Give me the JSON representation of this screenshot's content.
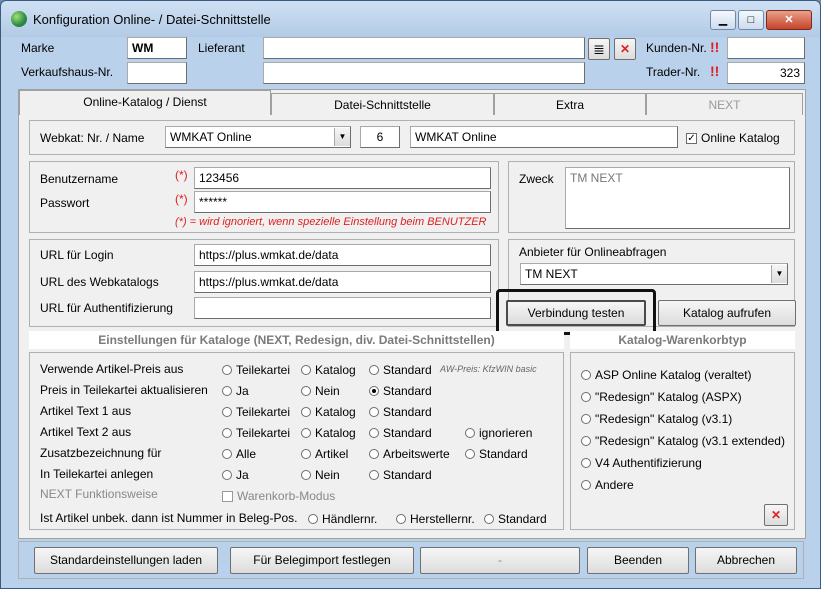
{
  "window": {
    "title": "Konfiguration Online- / Datei-Schnittstelle",
    "btn_min": "▁",
    "btn_max": "□",
    "btn_close": "✕"
  },
  "header": {
    "marke_label": "Marke",
    "marke_value": "WM",
    "lieferant_label": "Lieferant",
    "lieferant_value": "",
    "kunden_label": "Kunden-Nr.",
    "kunden_value": "",
    "verkaufshaus_label": "Verkaufshaus-Nr.",
    "verkaufshaus_value": "",
    "trader_label": "Trader-Nr.",
    "trader_value": "323",
    "warning_mark": "!!"
  },
  "tabs": [
    {
      "label": "Online-Katalog / Dienst",
      "active": true
    },
    {
      "label": "Datei-Schnittstelle",
      "active": false
    },
    {
      "label": "Extra",
      "active": false
    },
    {
      "label": "NEXT",
      "active": false,
      "disabled": true
    }
  ],
  "webkat": {
    "label": "Webkat: Nr. / Name",
    "select": "WMKAT Online",
    "nr": "6",
    "name": "WMKAT Online",
    "online_label": "Online Katalog",
    "online_checked": true
  },
  "login": {
    "user_label": "Benutzername",
    "user_value": "123456",
    "pass_label": "Passwort",
    "pass_value": "******",
    "asterisk": "(*)",
    "note": "(*) = wird ignoriert, wenn spezielle Einstellung beim BENUTZER"
  },
  "zweck": {
    "label": "Zweck",
    "value": "TM NEXT"
  },
  "urls": {
    "login_label": "URL für Login",
    "login_value": "https://plus.wmkat.de/data",
    "webkat_label": "URL des Webkatalogs",
    "webkat_value": "https://plus.wmkat.de/data",
    "auth_label": "URL für Authentifizierung",
    "auth_value": ""
  },
  "anbieter": {
    "label": "Anbieter für Onlineabfragen",
    "value": "TM NEXT"
  },
  "buttons": {
    "verbindung": "Verbindung testen",
    "katalog": "Katalog aufrufen"
  },
  "einstellungen": {
    "title": "Einstellungen für Kataloge (NEXT, Redesign, div. Datei-Schnittstellen)",
    "aw_note": "AW-Preis: KfzWIN basic",
    "rows": [
      {
        "label": "Verwende Artikel-Preis aus",
        "options": [
          "Teilekartei",
          "Katalog",
          "Standard"
        ],
        "selected": -1
      },
      {
        "label": "Preis in Teilekartei aktualisieren",
        "options": [
          "Ja",
          "Nein",
          "Standard"
        ],
        "selected": 2
      },
      {
        "label": "Artikel Text 1 aus",
        "options": [
          "Teilekartei",
          "Katalog",
          "Standard"
        ],
        "selected": -1
      },
      {
        "label": "Artikel Text 2 aus",
        "options": [
          "Teilekartei",
          "Katalog",
          "Standard",
          "ignorieren"
        ],
        "selected": -1
      },
      {
        "label": "Zusatzbezeichnung für",
        "options": [
          "Alle",
          "Artikel",
          "Arbeitswerte",
          "Standard"
        ],
        "selected": -1
      },
      {
        "label": "In Teilekartei anlegen",
        "options": [
          "Ja",
          "Nein",
          "Standard"
        ],
        "selected": -1
      }
    ],
    "next_label": "NEXT Funktionsweise",
    "next_option": "Warenkorb-Modus",
    "unbek_label": "Ist Artikel unbek. dann ist Nummer in Beleg-Pos.",
    "unbek_options": [
      "Händlernr.",
      "Herstellernr.",
      "Standard"
    ]
  },
  "warenkorb": {
    "title": "Katalog-Warenkorbtyp",
    "options": [
      "ASP Online Katalog (veraltet)",
      "\"Redesign\" Katalog (ASPX)",
      "\"Redesign\" Katalog (v3.1)",
      "\"Redesign\" Katalog (v3.1 extended)",
      "V4 Authentifizierung",
      "Andere"
    ],
    "delete_icon": "✕"
  },
  "footer": {
    "standard": "Standardeinstellungen laden",
    "belegimport": "Für Belegimport festlegen",
    "dash": "-",
    "beenden": "Beenden",
    "abbrechen": "Abbrechen"
  },
  "icons": {
    "list": "≣",
    "delete": "✕",
    "dropdown": "▼",
    "checkmark": "✓"
  },
  "colors": {
    "accent_red": "#e02020",
    "title_bg": "#b9d1ea"
  }
}
